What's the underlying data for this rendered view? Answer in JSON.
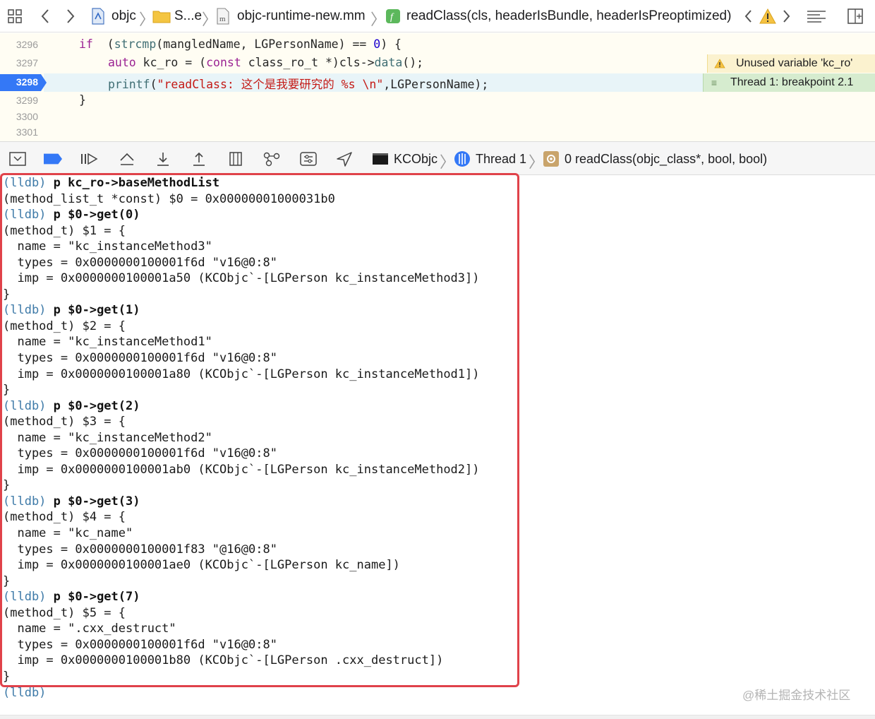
{
  "jump_bar": {
    "crumbs": [
      "objc",
      "S...e",
      "objc-runtime-new.mm",
      "readClass(cls, headerIsBundle, headerIsPreoptimized)"
    ]
  },
  "editor": {
    "lines": [
      {
        "num": "3296",
        "parts": [
          [
            "kw",
            "if"
          ],
          [
            "",
            "  ("
          ],
          [
            "fn",
            "strcmp"
          ],
          [
            "",
            "(mangledName, LGPersonName) == "
          ],
          [
            "num",
            "0"
          ],
          [
            "",
            ") {"
          ]
        ]
      },
      {
        "num": "3297",
        "parts": [
          [
            "kw",
            "auto"
          ],
          [
            "",
            " kc_ro = ("
          ],
          [
            "kw",
            "const"
          ],
          [
            "",
            " class_ro_t *)cls->"
          ],
          [
            "fn",
            "data"
          ],
          [
            "",
            "();"
          ]
        ]
      },
      {
        "num": "3298",
        "parts": [
          [
            "fn",
            "printf"
          ],
          [
            "",
            "("
          ],
          [
            "str",
            "\"readClass: 这个是我要研究的 %s \\n\""
          ],
          [
            "",
            ",LGPersonName);"
          ]
        ]
      },
      {
        "num": "3299",
        "parts": [
          [
            "",
            "}"
          ]
        ]
      },
      {
        "num": "3300",
        "parts": []
      },
      {
        "num": "3301",
        "parts": []
      }
    ],
    "warning_text": "Unused variable 'kc_ro'",
    "breakpoint_text": "Thread 1: breakpoint 2.1"
  },
  "debug_bar": {
    "target": "KCObjc",
    "thread": "Thread 1",
    "frame": "0 readClass(objc_class*, bool, bool)"
  },
  "console": {
    "lines": [
      {
        "prompt": "(lldb)",
        "cmd": " p kc_ro->baseMethodList"
      },
      {
        "text": "(method_list_t *const) $0 = 0x00000001000031b0"
      },
      {
        "prompt": "(lldb)",
        "cmd": " p $0->get(0)"
      },
      {
        "text": "(method_t) $1 = {"
      },
      {
        "text": "  name = \"kc_instanceMethod3\""
      },
      {
        "text": "  types = 0x0000000100001f6d \"v16@0:8\""
      },
      {
        "text": "  imp = 0x0000000100001a50 (KCObjc`-[LGPerson kc_instanceMethod3])"
      },
      {
        "text": "}"
      },
      {
        "prompt": "(lldb)",
        "cmd": " p $0->get(1)"
      },
      {
        "text": "(method_t) $2 = {"
      },
      {
        "text": "  name = \"kc_instanceMethod1\""
      },
      {
        "text": "  types = 0x0000000100001f6d \"v16@0:8\""
      },
      {
        "text": "  imp = 0x0000000100001a80 (KCObjc`-[LGPerson kc_instanceMethod1])"
      },
      {
        "text": "}"
      },
      {
        "prompt": "(lldb)",
        "cmd": " p $0->get(2)"
      },
      {
        "text": "(method_t) $3 = {"
      },
      {
        "text": "  name = \"kc_instanceMethod2\""
      },
      {
        "text": "  types = 0x0000000100001f6d \"v16@0:8\""
      },
      {
        "text": "  imp = 0x0000000100001ab0 (KCObjc`-[LGPerson kc_instanceMethod2])"
      },
      {
        "text": "}"
      },
      {
        "prompt": "(lldb)",
        "cmd": " p $0->get(3)"
      },
      {
        "text": "(method_t) $4 = {"
      },
      {
        "text": "  name = \"kc_name\""
      },
      {
        "text": "  types = 0x0000000100001f83 \"@16@0:8\""
      },
      {
        "text": "  imp = 0x0000000100001ae0 (KCObjc`-[LGPerson kc_name])"
      },
      {
        "text": "}"
      },
      {
        "prompt": "(lldb)",
        "cmd": " p $0->get(7)"
      },
      {
        "text": "(method_t) $5 = {"
      },
      {
        "text": "  name = \".cxx_destruct\""
      },
      {
        "text": "  types = 0x0000000100001f6d \"v16@0:8\""
      },
      {
        "text": "  imp = 0x0000000100001b80 (KCObjc`-[LGPerson .cxx_destruct])"
      },
      {
        "text": "}"
      },
      {
        "prompt": "(lldb)",
        "cmd": ""
      }
    ]
  },
  "watermark": "@稀土掘金技术社区",
  "colors": {
    "prompt": "#3e7aa8",
    "highlight_border": "#e0424a",
    "current_line": "#e8f4f8",
    "breakpoint": "#3478f6",
    "warning": "#f5c242"
  }
}
